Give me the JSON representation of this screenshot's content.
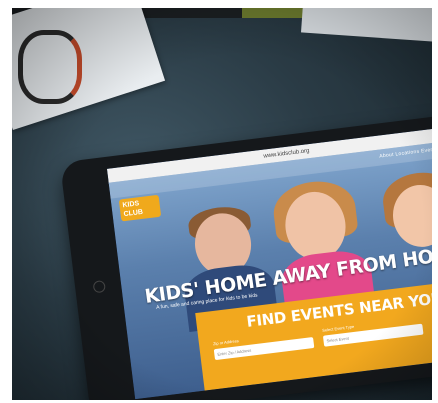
{
  "website": {
    "browser_url": "www.kidsclub.org",
    "logo_text": "KIDS CLUB",
    "nav_text": "About  Locations  Events  Contact",
    "headline": "KIDS' HOME AWAY FROM HOME",
    "subline": "A fun, safe and caring place for kids to be kids",
    "panel_title": "FIND EVENTS NEAR YOU",
    "field1_label": "Zip or Address",
    "field1_placeholder": "Enter Zip / Address",
    "field2_label": "Select Event Type",
    "field2_placeholder": "Select Event"
  },
  "colors": {
    "accent": "#f2a81e",
    "hero_blue": "#3e5f8e",
    "button_blue": "#2f5fa8"
  }
}
